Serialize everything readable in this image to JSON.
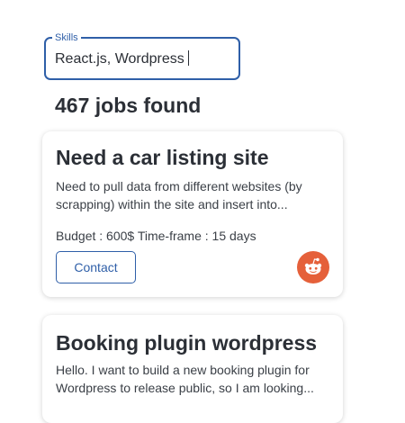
{
  "skills_field": {
    "label": "Skills",
    "value": "React.js, Wordpress"
  },
  "results": {
    "count_text": "467 jobs found"
  },
  "jobs": [
    {
      "title": "Need a car listing site",
      "description": "Need to pull data from different websites (by scrapping) within the site and insert into...",
      "budget_label": "Budget : 600$",
      "timeframe_label": "Time-frame : 15 days",
      "contact_label": "Contact",
      "source_icon": "reddit-icon",
      "source_color": "#e5603a"
    },
    {
      "title": "Booking plugin wordpress",
      "description": "Hello. I want to build a new booking plugin for Wordpress to release public, so I am looking..."
    }
  ],
  "colors": {
    "accent": "#2f5fa8",
    "text": "#2b2f36"
  }
}
